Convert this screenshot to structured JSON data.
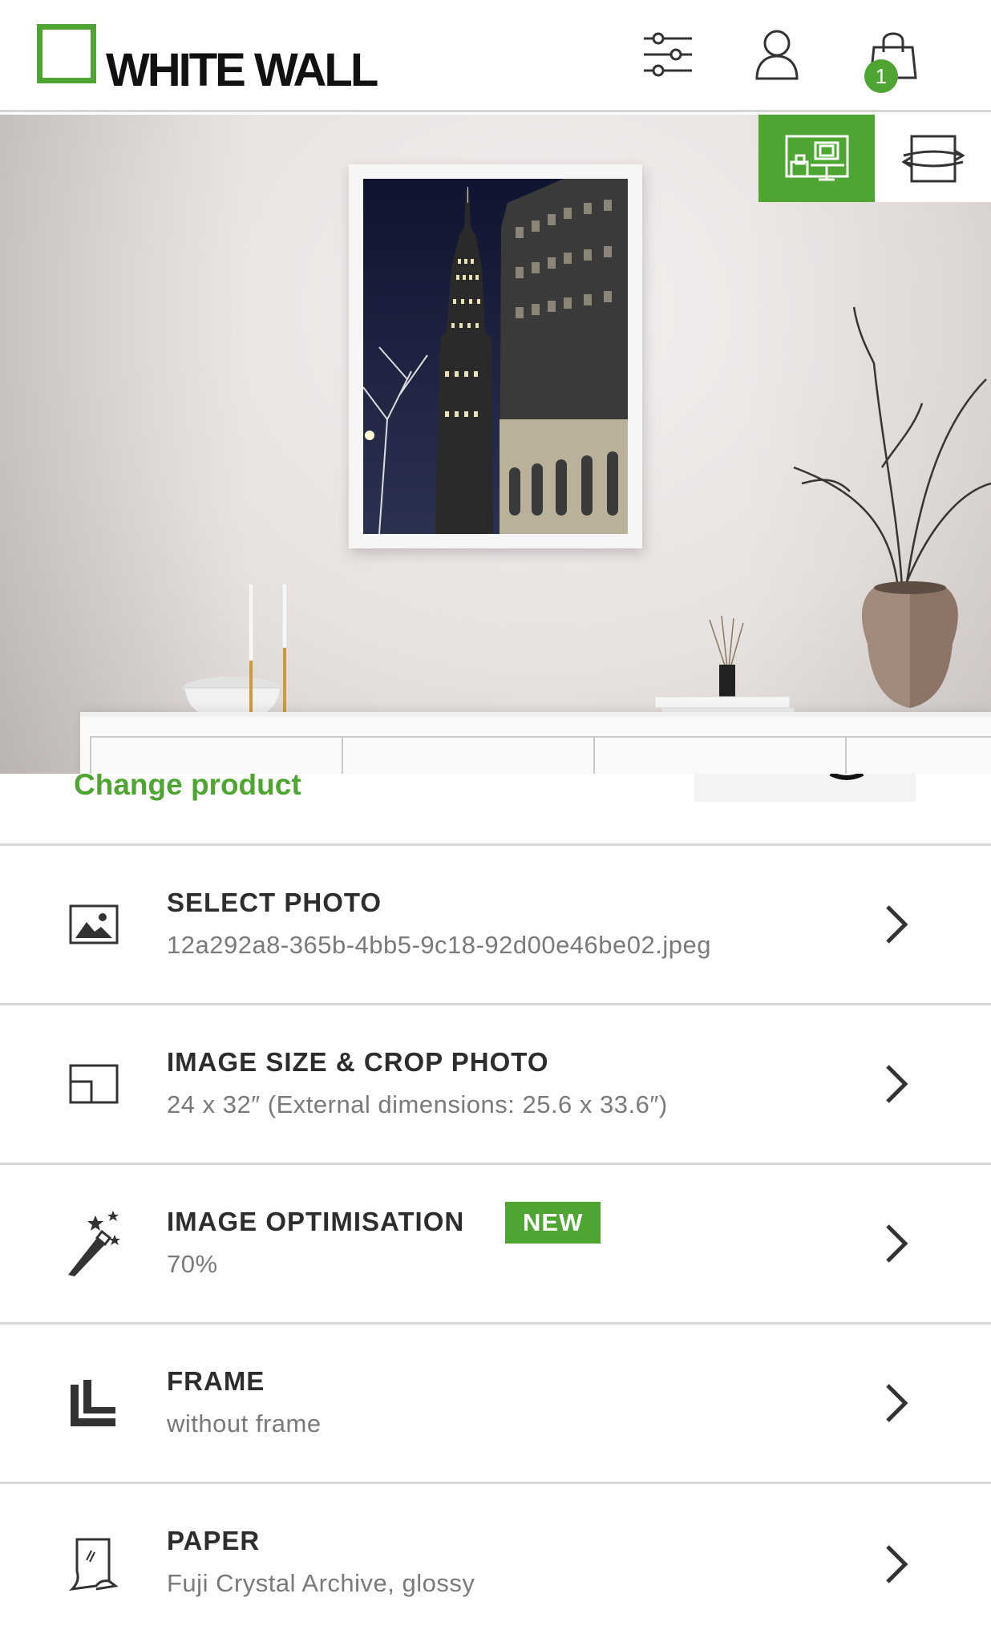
{
  "header": {
    "logo_text": "WHITE WALL",
    "cart_count": "1",
    "icons": [
      "filter-sliders-icon",
      "user-icon",
      "shopping-bag-icon"
    ]
  },
  "preview": {
    "view_toggle": [
      "room-view-icon",
      "rotate-view-icon"
    ],
    "active_view": "room-view"
  },
  "change_product": {
    "label": "Change product"
  },
  "options": [
    {
      "title": "SELECT PHOTO",
      "value": "12a292a8-365b-4bb5-9c18-92d00e46be02.jpeg",
      "icon": "image-icon"
    },
    {
      "title": "IMAGE SIZE & CROP PHOTO",
      "value": "24 x 32″ (External dimensions: 25.6 x 33.6″)",
      "icon": "crop-size-icon"
    },
    {
      "title": "IMAGE OPTIMISATION",
      "value": "70%",
      "badge": "NEW",
      "icon": "magic-wand-icon"
    },
    {
      "title": "FRAME",
      "value": "without frame",
      "icon": "frame-corner-icon"
    },
    {
      "title": "PAPER",
      "value": "Fuji Crystal Archive, glossy",
      "icon": "paper-icon"
    }
  ],
  "colors": {
    "accent": "#4ea532",
    "text": "#2d2d2d",
    "subtext": "#7a7a7a",
    "divider": "#d8d8d8"
  }
}
